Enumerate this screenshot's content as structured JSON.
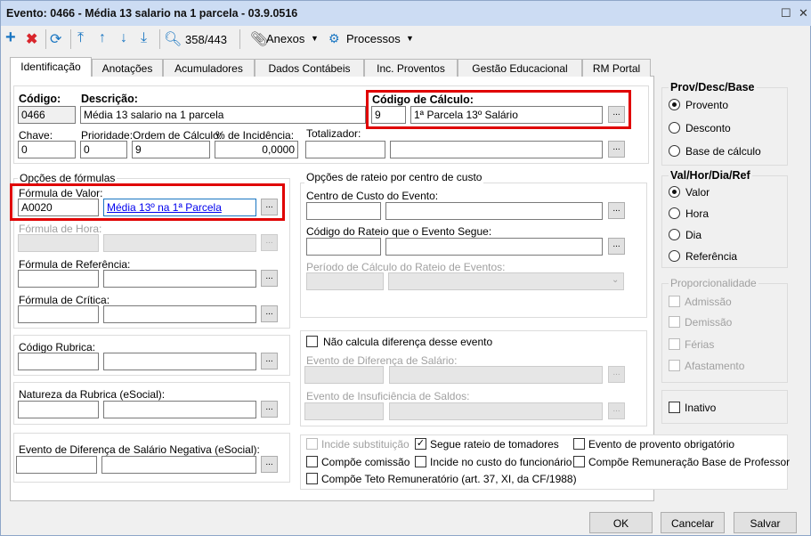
{
  "window": {
    "title": "Evento: 0466 - Média 13 salario na 1 parcela - 03.9.0516"
  },
  "toolbar": {
    "record_counter": "358/443",
    "attachments": "Anexos",
    "processes": "Processos"
  },
  "tabs": [
    "Identificação",
    "Anotações",
    "Acumuladores",
    "Dados Contábeis",
    "Inc. Proventos",
    "Gestão Educacional",
    "RM Portal"
  ],
  "identification": {
    "codigo_label": "Código:",
    "codigo": "0466",
    "descricao_label": "Descrição:",
    "descricao": "Média 13 salario na 1 parcela",
    "codigo_calculo_label": "Código de Cálculo:",
    "codigo_calculo": "9",
    "codigo_calculo_desc": "1ª Parcela 13º Salário",
    "chave_label": "Chave:",
    "chave": "0",
    "prioridade_label": "Prioridade:",
    "prioridade": "0",
    "ordem_label": "Ordem de Cálculo:",
    "ordem": "9",
    "incidencia_label": "% de Incidência:",
    "incidencia": "0,0000",
    "totalizador_label": "Totalizador:"
  },
  "formulas": {
    "title": "Opções de fórmulas",
    "valor_label": "Fórmula de Valor:",
    "valor_code": "A0020",
    "valor_desc": "Média 13º na 1ª Parcela",
    "hora_label": "Fórmula de Hora:",
    "referencia_label": "Fórmula de Referência:",
    "critica_label": "Fórmula de Crítica:"
  },
  "rubrica": {
    "codigo_label": "Código Rubrica:",
    "natureza_label": "Natureza da Rubrica (eSocial):",
    "dif_negativa_label": "Evento de Diferença de Salário Negativa (eSocial):"
  },
  "rateio": {
    "title": "Opções de rateio por centro de custo",
    "centro_label": "Centro de Custo do Evento:",
    "codigo_rateio_label": "Código do Rateio que o Evento Segue:",
    "periodo_label": "Período de Cálculo do Rateio de Eventos:"
  },
  "diferenca": {
    "nao_calcula": "Não calcula diferença desse evento",
    "dif_salario_label": "Evento de Diferença de Salário:",
    "insuficiencia_label": "Evento de Insuficiência de Saldos:"
  },
  "checks": [
    {
      "label": "Incide substituição",
      "checked": false,
      "disabled": true
    },
    {
      "label": "Segue rateio de tomadores",
      "checked": true,
      "disabled": false
    },
    {
      "label": "Evento de provento obrigatório",
      "checked": false,
      "disabled": false
    },
    {
      "label": "Compõe comissão",
      "checked": false,
      "disabled": false
    },
    {
      "label": "Incide no custo do funcionário",
      "checked": false,
      "disabled": false
    },
    {
      "label": "Compõe Remuneração Base de Professor",
      "checked": false,
      "disabled": false
    },
    {
      "label": "Compõe Teto Remuneratório (art. 37, XI, da CF/1988)",
      "checked": false,
      "disabled": false
    }
  ],
  "prov": {
    "title": "Prov/Desc/Base",
    "options": [
      "Provento",
      "Desconto",
      "Base de cálculo"
    ],
    "selected": "Provento"
  },
  "val": {
    "title": "Val/Hor/Dia/Ref",
    "options": [
      "Valor",
      "Hora",
      "Dia",
      "Referência"
    ],
    "selected": "Valor"
  },
  "proporcionalidade": {
    "title": "Proporcionalidade",
    "options": [
      "Admissão",
      "Demissão",
      "Férias",
      "Afastamento"
    ]
  },
  "inativo": "Inativo",
  "buttons": {
    "ok": "OK",
    "cancel": "Cancelar",
    "save": "Salvar",
    "ellipsis": "..."
  },
  "colors": {
    "title_bar": "#ccdcf3",
    "highlight": "#e00000",
    "link": "#0000ee",
    "icon_blue": "#1a76c2",
    "delete_red": "#d9262c"
  }
}
